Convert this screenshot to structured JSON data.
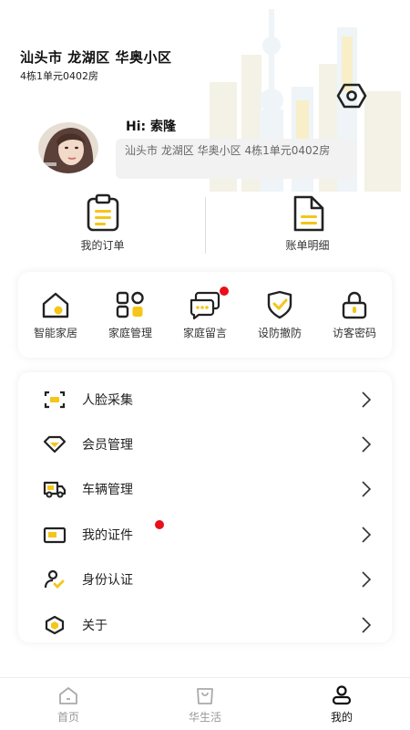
{
  "header": {
    "address_title": "汕头市 龙湖区 华奥小区",
    "address_unit": "4栋1单元0402房"
  },
  "profile": {
    "greeting": "Hi: 索隆",
    "address_full": "汕头市 龙湖区 华奥小区  4栋1单元0402房"
  },
  "quick_actions": [
    {
      "label": "我的订单",
      "icon": "clipboard-icon"
    },
    {
      "label": "账单明细",
      "icon": "document-icon"
    }
  ],
  "services": [
    {
      "label": "智能家居",
      "icon": "home-icon",
      "badge": false
    },
    {
      "label": "家庭管理",
      "icon": "grid-icon",
      "badge": false
    },
    {
      "label": "家庭留言",
      "icon": "message-icon",
      "badge": true
    },
    {
      "label": "设防撤防",
      "icon": "shield-check-icon",
      "badge": false
    },
    {
      "label": "访客密码",
      "icon": "lock-icon",
      "badge": false
    }
  ],
  "menu": [
    {
      "label": "人脸采集",
      "icon": "face-scan-icon",
      "badge": false
    },
    {
      "label": "会员管理",
      "icon": "diamond-icon",
      "badge": false
    },
    {
      "label": "车辆管理",
      "icon": "truck-icon",
      "badge": false
    },
    {
      "label": "我的证件",
      "icon": "id-card-icon",
      "badge": true
    },
    {
      "label": "身份认证",
      "icon": "user-check-icon",
      "badge": false
    },
    {
      "label": "关于",
      "icon": "hexagon-info-icon",
      "badge": false
    }
  ],
  "bottom_nav": [
    {
      "label": "首页",
      "icon": "house-icon",
      "active": false
    },
    {
      "label": "华生活",
      "icon": "bag-icon",
      "active": false
    },
    {
      "label": "我的",
      "icon": "person-icon",
      "active": true
    }
  ],
  "colors": {
    "accent": "#F5C518",
    "badge": "#E8101A",
    "icon_stroke": "#222222"
  }
}
